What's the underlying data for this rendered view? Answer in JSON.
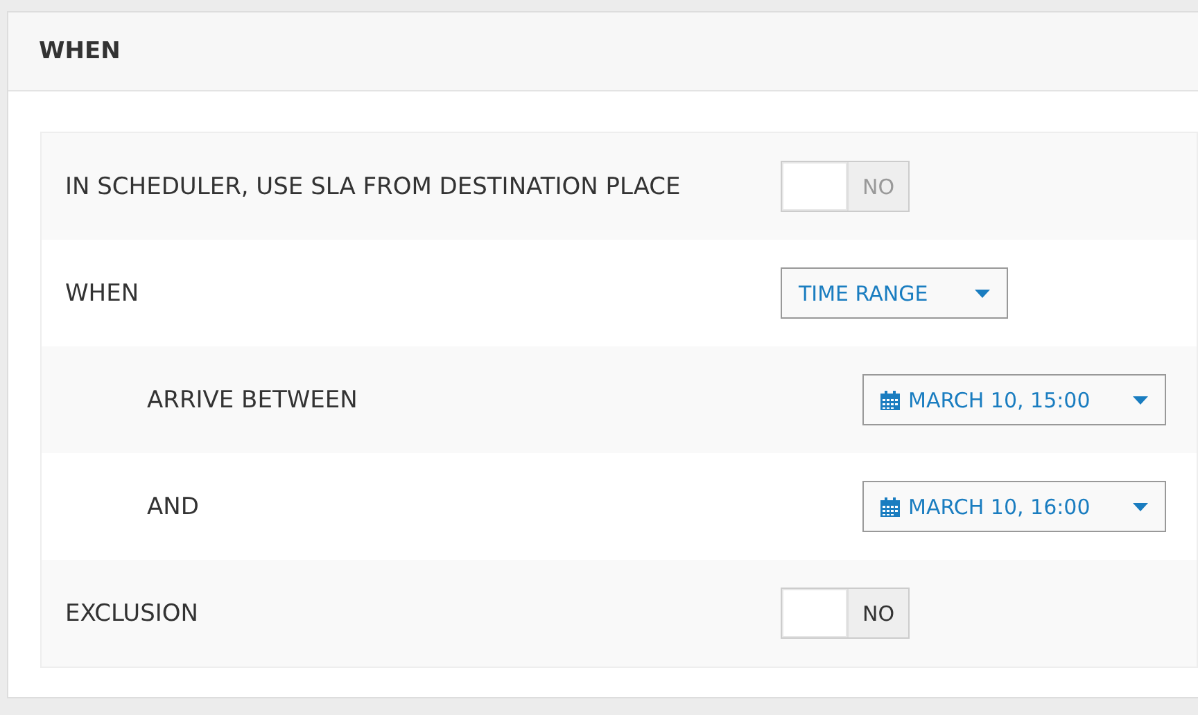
{
  "panel": {
    "title": "WHEN"
  },
  "rows": [
    {
      "kind": "toggle",
      "label": "IN SCHEDULER, USE SLA FROM DESTINATION PLACE",
      "value": "NO",
      "on": false,
      "disabled": true
    },
    {
      "kind": "select",
      "label": "WHEN",
      "value": "TIME RANGE",
      "children": [
        {
          "kind": "datetime",
          "label": "ARRIVE BETWEEN",
          "value": "MARCH 10, 15:00"
        },
        {
          "kind": "datetime",
          "label": "AND",
          "value": "MARCH 10, 16:00"
        }
      ]
    },
    {
      "kind": "toggle",
      "label": "EXCLUSION",
      "value": "NO",
      "on": false,
      "disabled": false
    }
  ]
}
